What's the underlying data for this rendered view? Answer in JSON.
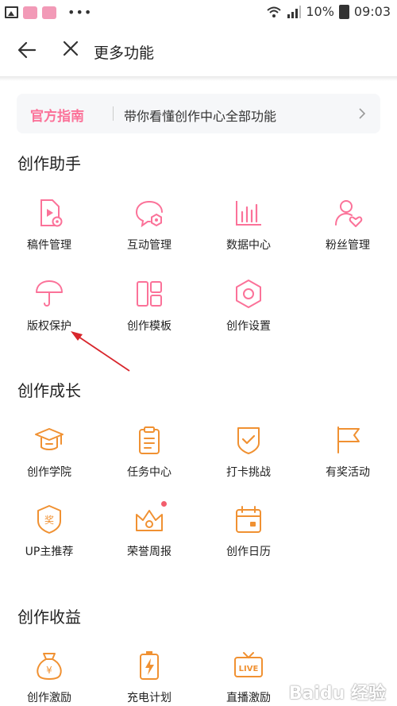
{
  "status_bar": {
    "battery": "10%",
    "time": "09:03",
    "overflow": "•••"
  },
  "header": {
    "title": "更多功能"
  },
  "guide": {
    "tag": "官方指南",
    "text": "带你看懂创作中心全部功能"
  },
  "sections": [
    {
      "title": "创作助手",
      "color": "#fb7299",
      "items": [
        {
          "label": "稿件管理",
          "icon": "video-file-icon"
        },
        {
          "label": "互动管理",
          "icon": "chat-bubble-icon"
        },
        {
          "label": "数据中心",
          "icon": "bar-chart-icon"
        },
        {
          "label": "粉丝管理",
          "icon": "fan-heart-icon"
        },
        {
          "label": "版权保护",
          "icon": "umbrella-icon"
        },
        {
          "label": "创作模板",
          "icon": "template-icon"
        },
        {
          "label": "创作设置",
          "icon": "hexagon-settings-icon"
        }
      ]
    },
    {
      "title": "创作成长",
      "color": "#f09132",
      "items": [
        {
          "label": "创作学院",
          "icon": "graduation-cap-icon"
        },
        {
          "label": "任务中心",
          "icon": "clipboard-icon"
        },
        {
          "label": "打卡挑战",
          "icon": "shield-check-icon"
        },
        {
          "label": "有奖活动",
          "icon": "flag-icon"
        },
        {
          "label": "UP主推荐",
          "icon": "award-badge-icon"
        },
        {
          "label": "荣誉周报",
          "icon": "crown-icon"
        },
        {
          "label": "创作日历",
          "icon": "calendar-icon"
        }
      ]
    },
    {
      "title": "创作收益",
      "color": "#f09132",
      "items": [
        {
          "label": "创作激励",
          "icon": "money-bag-icon"
        },
        {
          "label": "充电计划",
          "icon": "battery-charge-icon"
        },
        {
          "label": "直播激励",
          "icon": "live-tv-icon"
        }
      ]
    }
  ],
  "watermark": "Baidu 经验"
}
